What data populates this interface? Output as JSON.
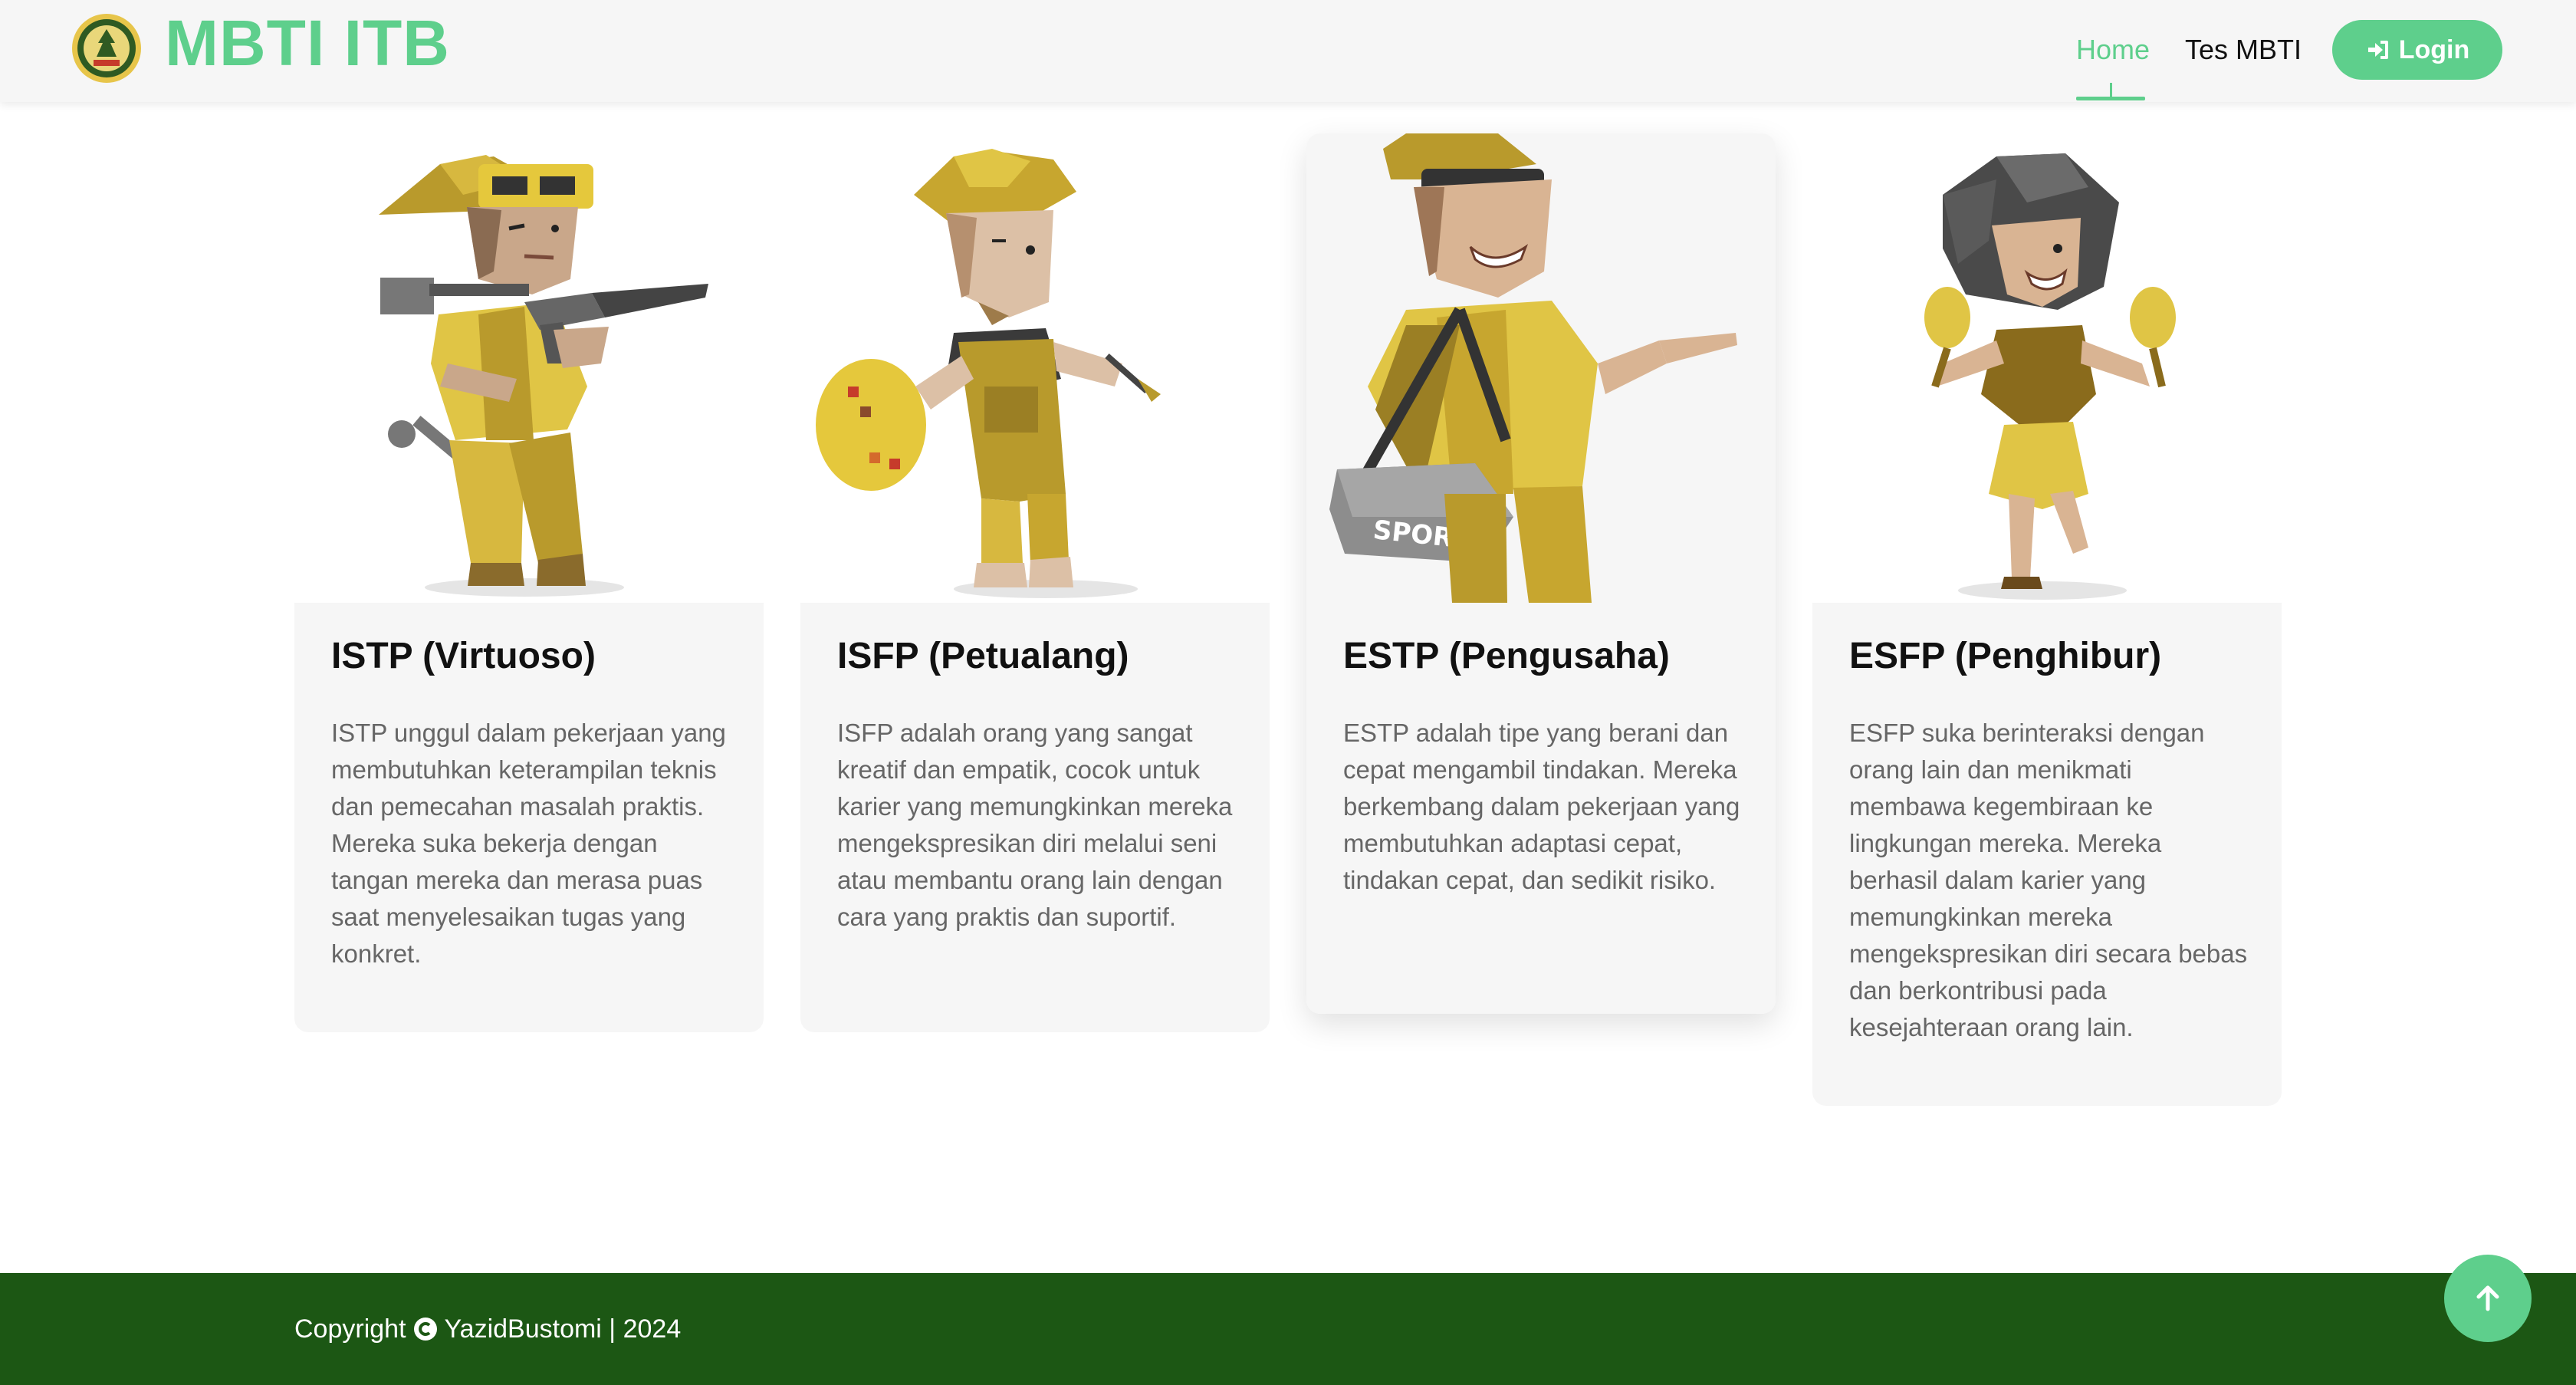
{
  "brand": {
    "name": "MBTI ITB",
    "logo": "itb-crest-logo"
  },
  "nav": {
    "items": [
      {
        "label": "Home",
        "active": true
      },
      {
        "label": "Tes MBTI",
        "active": false
      }
    ],
    "login": {
      "label": "Login",
      "icon": "sign-in-icon"
    }
  },
  "cards": [
    {
      "title": "ISTP (Virtuoso)",
      "description": "ISTP unggul dalam pekerjaan yang membutuhkan keterampilan teknis dan pemecahan masalah praktis. Mereka suka bekerja dengan tangan mereka dan merasa puas saat menyelesaikan tugas yang konkret.",
      "illustration": "virtuoso-character"
    },
    {
      "title": "ISFP (Petualang)",
      "description": "ISFP adalah orang yang sangat kreatif dan empatik, cocok untuk karier yang memungkinkan mereka mengekspresikan diri melalui seni atau membantu orang lain dengan cara yang praktis dan suportif.",
      "illustration": "adventurer-character"
    },
    {
      "title": "ESTP (Pengusaha)",
      "description": "ESTP adalah tipe yang berani dan cepat mengambil tindakan. Mereka berkembang dalam pekerjaan yang membutuhkan adaptasi cepat, tindakan cepat, dan sedikit risiko.",
      "illustration": "entrepreneur-character",
      "bag_label": "SPORT"
    },
    {
      "title": "ESFP (Penghibur)",
      "description": "ESFP suka berinteraksi dengan orang lain dan menikmati membawa kegembiraan ke lingkungan mereka. Mereka berhasil dalam karier yang memungkinkan mereka mengekspresikan diri secara bebas dan berkontribusi pada kesejahteraan orang lain.",
      "illustration": "entertainer-character"
    }
  ],
  "footer": {
    "copyright_prefix": "Copyright",
    "copyright_owner": "YazidBustomi | 2024",
    "back_to_top_icon": "arrow-up-icon"
  },
  "colors": {
    "accent": "#5ecf8c",
    "footer_bg": "#1c5714",
    "card_bg": "#f6f6f6"
  }
}
